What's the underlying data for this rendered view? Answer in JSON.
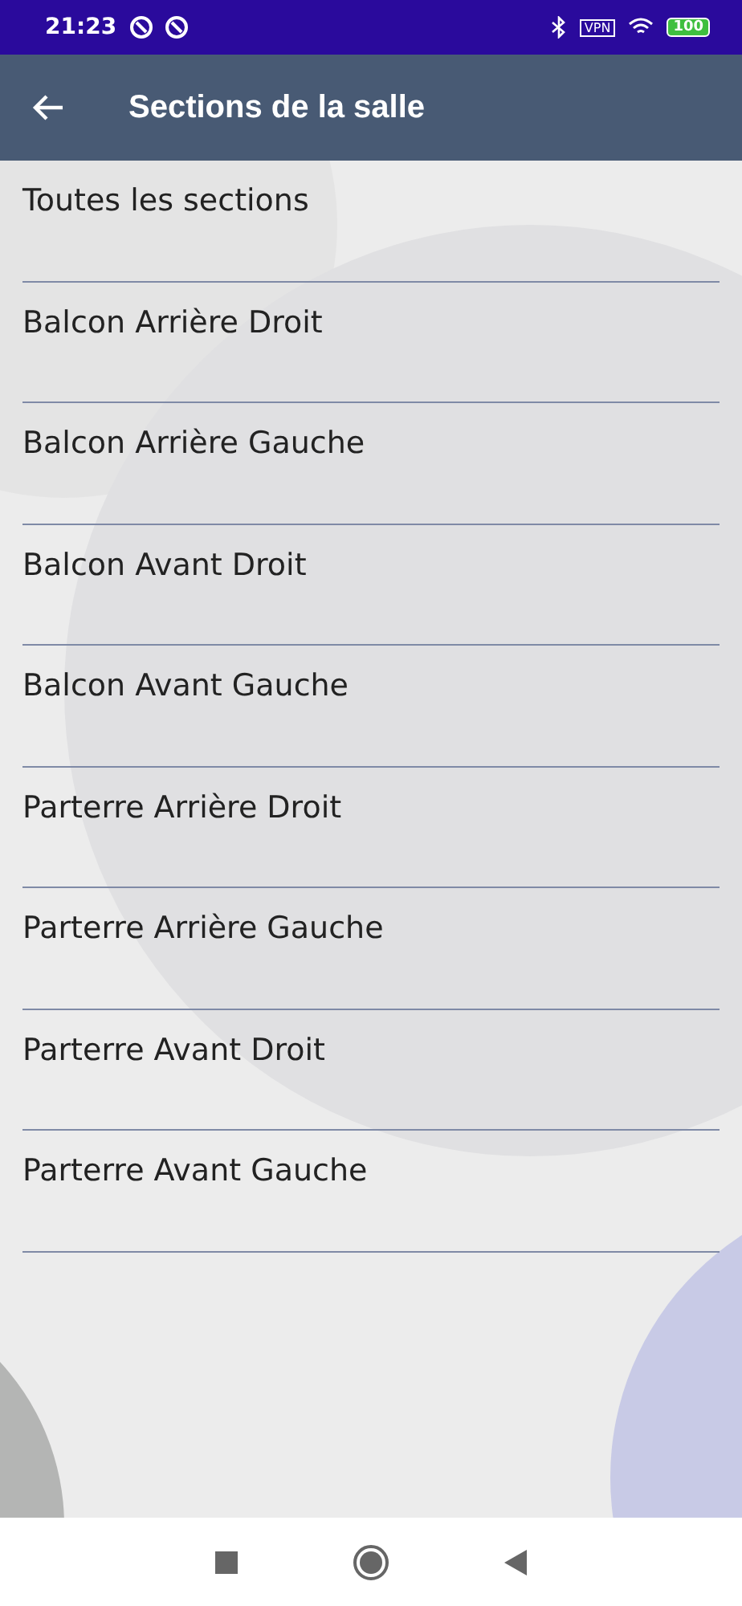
{
  "status_bar": {
    "time": "21:23",
    "vpn": "VPN",
    "battery": "100"
  },
  "app_bar": {
    "title": "Sections de la salle"
  },
  "sections": [
    {
      "label": "Toutes les sections"
    },
    {
      "label": "Balcon Arrière Droit"
    },
    {
      "label": "Balcon Arrière Gauche"
    },
    {
      "label": "Balcon Avant Droit"
    },
    {
      "label": "Balcon Avant Gauche"
    },
    {
      "label": "Parterre Arrière Droit"
    },
    {
      "label": "Parterre Arrière Gauche"
    },
    {
      "label": "Parterre Avant Droit"
    },
    {
      "label": "Parterre Avant Gauche"
    }
  ]
}
